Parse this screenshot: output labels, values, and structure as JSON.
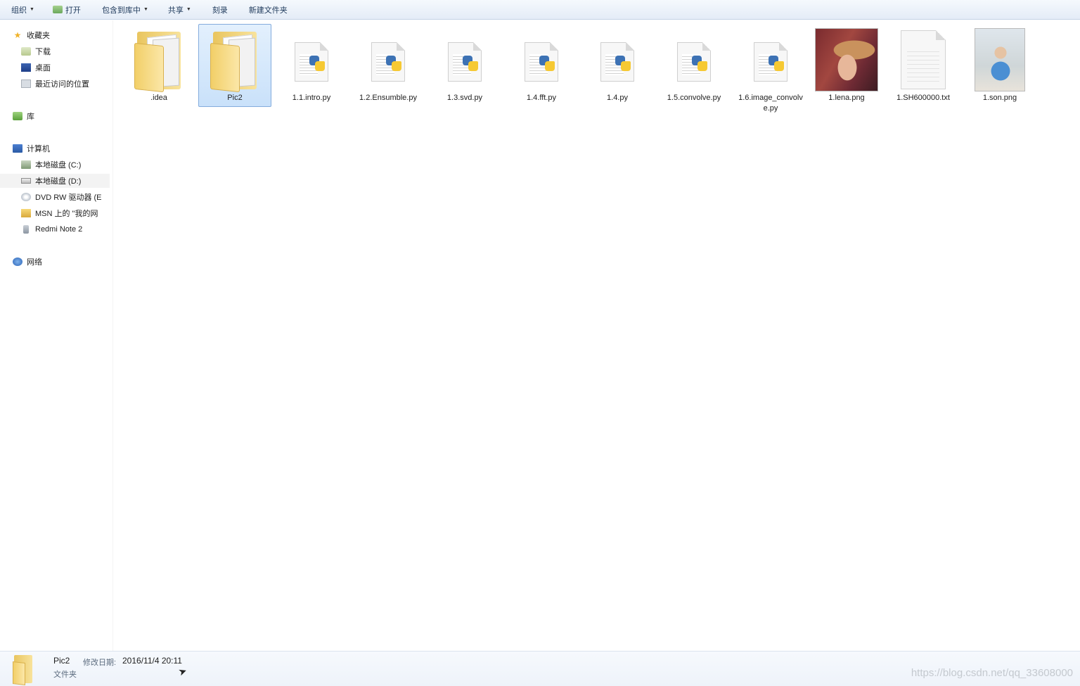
{
  "toolbar": {
    "organize": "组织",
    "open": "打开",
    "include_in_library": "包含到库中",
    "share": "共享",
    "burn": "刻录",
    "new_folder": "新建文件夹"
  },
  "sidebar": {
    "favorites": "收藏夹",
    "downloads": "下载",
    "desktop": "桌面",
    "recent_places": "最近访问的位置",
    "libraries": "库",
    "computer": "计算机",
    "drive_c": "本地磁盘 (C:)",
    "drive_d": "本地磁盘 (D:)",
    "dvd_drive": "DVD RW 驱动器 (E",
    "msn": "MSN 上的 \"我的网",
    "redmi": "Redmi Note 2",
    "network": "网络"
  },
  "files": [
    {
      "name": ".idea",
      "type": "folder"
    },
    {
      "name": "Pic2",
      "type": "folder",
      "selected": true
    },
    {
      "name": "1.1.intro.py",
      "type": "python"
    },
    {
      "name": "1.2.Ensumble.py",
      "type": "python"
    },
    {
      "name": "1.3.svd.py",
      "type": "python"
    },
    {
      "name": "1.4.fft.py",
      "type": "python"
    },
    {
      "name": "1.4.py",
      "type": "python"
    },
    {
      "name": "1.5.convolve.py",
      "type": "python"
    },
    {
      "name": "1.6.image_convolve.py",
      "type": "python"
    },
    {
      "name": "1.lena.png",
      "type": "image"
    },
    {
      "name": "1.SH600000.txt",
      "type": "text"
    },
    {
      "name": "1.son.png",
      "type": "image"
    }
  ],
  "details": {
    "name": "Pic2",
    "modified_label": "修改日期:",
    "modified_value": "2016/11/4 20:11",
    "type": "文件夹"
  },
  "watermark": "https://blog.csdn.net/qq_33608000"
}
